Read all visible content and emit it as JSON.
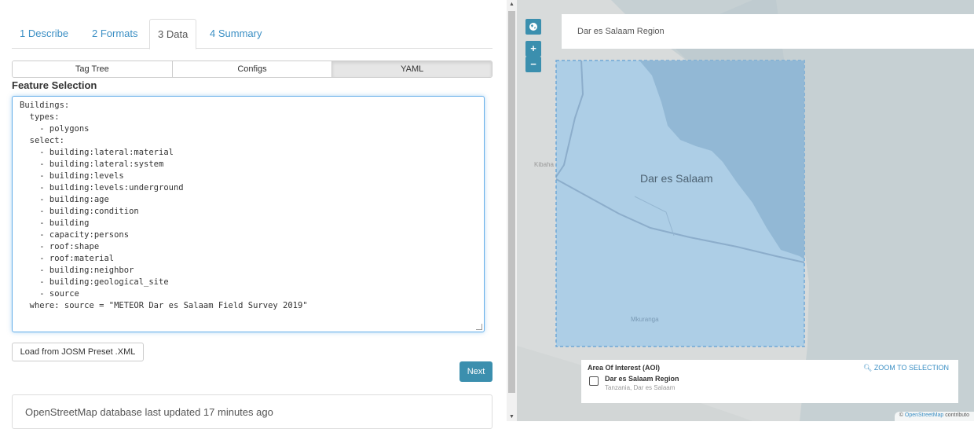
{
  "tabs": [
    {
      "label": "1 Describe"
    },
    {
      "label": "2 Formats"
    },
    {
      "label": "3 Data"
    },
    {
      "label": "4 Summary"
    }
  ],
  "segments": [
    {
      "label": "Tag Tree"
    },
    {
      "label": "Configs"
    },
    {
      "label": "YAML"
    }
  ],
  "feature_selection": {
    "title": "Feature Selection",
    "yaml": "Buildings:\n  types:\n    - polygons\n  select:\n    - building:lateral:material\n    - building:lateral:system\n    - building:levels\n    - building:levels:underground\n    - building:age\n    - building:condition\n    - building\n    - capacity:persons\n    - roof:shape\n    - roof:material\n    - building:neighbor\n    - building:geological_site\n    - source\n  where: source = \"METEOR Dar es Salaam Field Survey 2019\""
  },
  "buttons": {
    "josm": "Load from JOSM Preset .XML",
    "next": "Next"
  },
  "status": "OpenStreetMap database last updated 17 minutes ago",
  "map": {
    "search_value": "Dar es Salaam Region",
    "zoom_in": "+",
    "zoom_out": "−",
    "labels": {
      "city": "Dar es Salaam",
      "kibaha": "Kibaha",
      "mkuranga": "Mkuranga"
    },
    "aoi": {
      "header": "Area Of Interest (AOI)",
      "zoom_link": "ZOOM TO SELECTION",
      "name": "Dar es Salaam Region",
      "sub": "Tanzania, Dar es Salaam"
    },
    "attribution": {
      "prefix": "© ",
      "link": "OpenStreetMap",
      "suffix": " contributo"
    }
  },
  "colors": {
    "accent": "#3b8fae",
    "link": "#3b8fc4",
    "selection_fill": "#a6cbe8",
    "water": "#8fb6d3"
  }
}
